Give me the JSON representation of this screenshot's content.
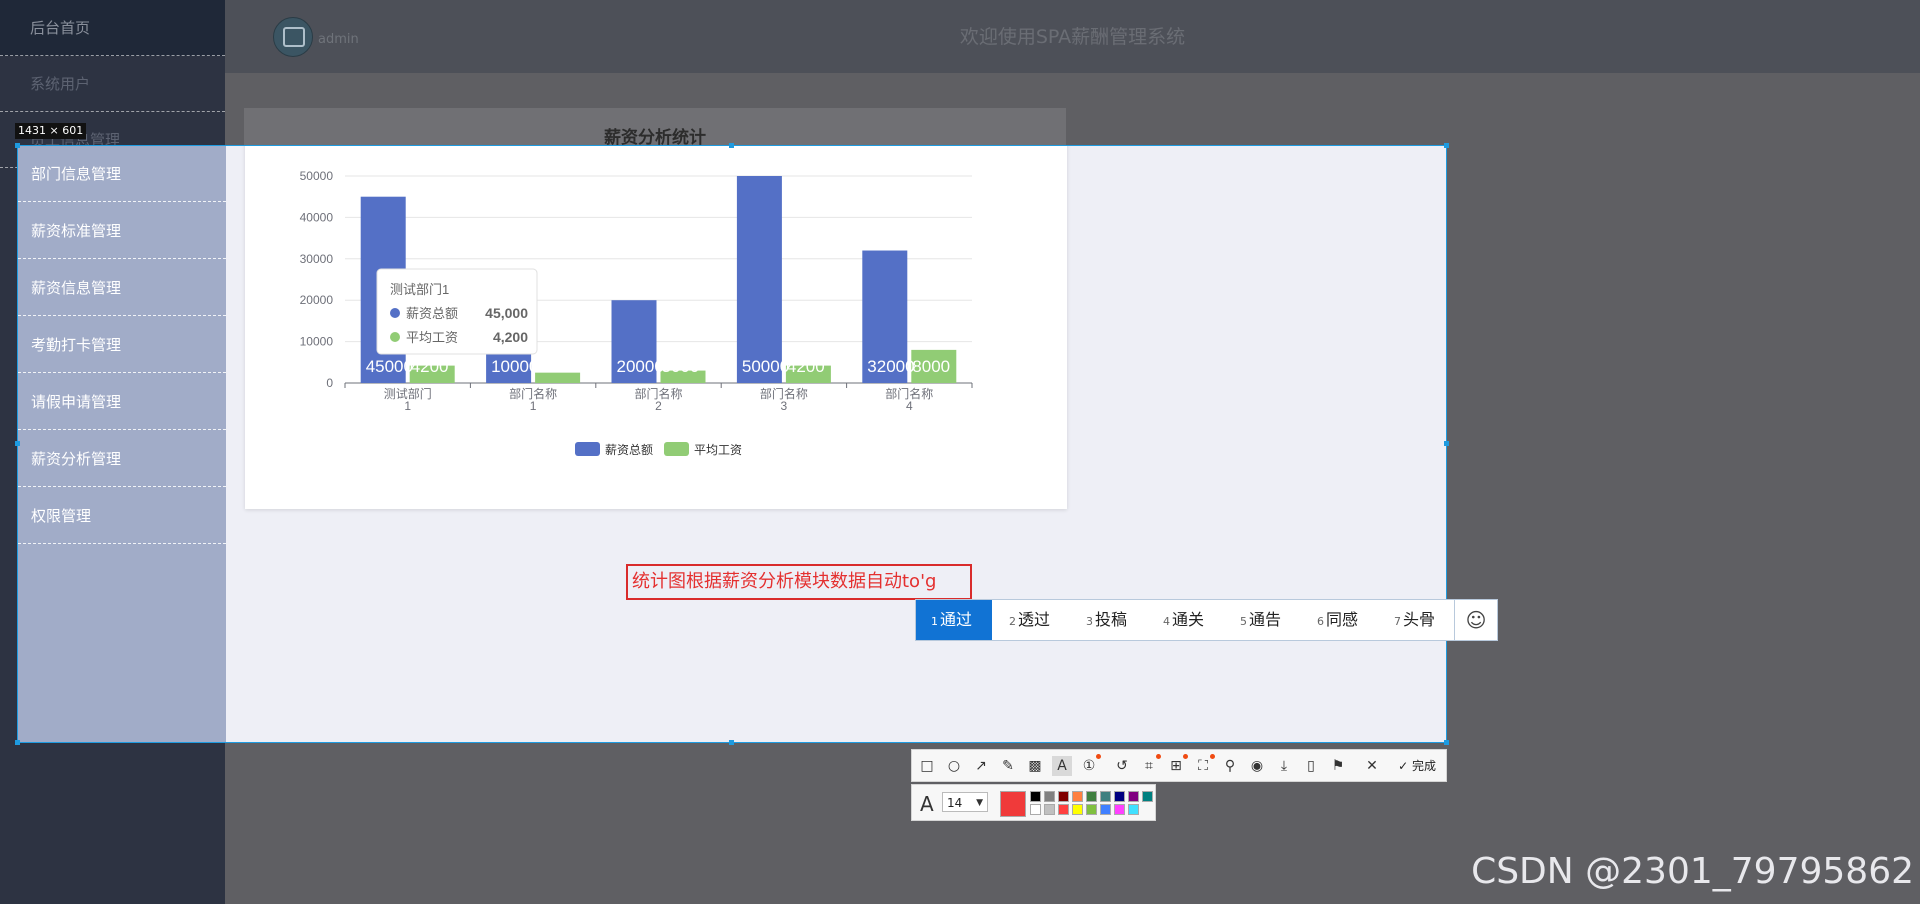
{
  "header": {
    "title": "欢迎使用SPA薪酬管理系统",
    "admin_name": "admin"
  },
  "sidebar": {
    "items": [
      {
        "label": "后台首页"
      },
      {
        "label": "系统用户"
      },
      {
        "label": "员工信息管理"
      },
      {
        "label": "部门信息管理"
      },
      {
        "label": "薪资标准管理"
      },
      {
        "label": "薪资信息管理"
      },
      {
        "label": "考勤打卡管理"
      },
      {
        "label": "请假申请管理"
      },
      {
        "label": "薪资分析管理"
      },
      {
        "label": "权限管理"
      }
    ]
  },
  "screenshot_tool": {
    "size_label": "1431 × 601",
    "text_annotation": "统计图根据薪资分析模块数据自动to'g",
    "font_size": "14",
    "done_label": "完成",
    "current_color": "#f03a3a",
    "palette": [
      "#000000",
      "#808080",
      "#800000",
      "#ff8040",
      "#408040",
      "#408080",
      "#000080",
      "#800080",
      "#008080",
      "#ffffff",
      "#c0c0c0",
      "#ff4040",
      "#ffff00",
      "#80c040",
      "#4080ff",
      "#ff40ff",
      "#40e0ff"
    ],
    "tools": [
      "rectangle-icon",
      "ellipse-icon",
      "arrow-icon",
      "pencil-icon",
      "mosaic-icon",
      "text-icon",
      "number-icon",
      "undo-icon",
      "ocr-icon",
      "translate-icon",
      "scan-icon",
      "pin-icon",
      "record-icon",
      "download-icon",
      "long-screenshot-icon",
      "bookmark-icon",
      "close-icon"
    ]
  },
  "ime": {
    "candidates": [
      {
        "num": "1",
        "text": "通过"
      },
      {
        "num": "2",
        "text": "透过"
      },
      {
        "num": "3",
        "text": "投稿"
      },
      {
        "num": "4",
        "text": "通关"
      },
      {
        "num": "5",
        "text": "通告"
      },
      {
        "num": "6",
        "text": "同感"
      },
      {
        "num": "7",
        "text": "头骨"
      }
    ],
    "emoji": "☺"
  },
  "watermark": "CSDN @2301_79795862",
  "chart_data": {
    "type": "bar",
    "title": "薪资分析统计",
    "categories": [
      "测试部门1",
      "部门名称1",
      "部门名称2",
      "部门名称3",
      "部门名称4"
    ],
    "category_lines": [
      [
        "测试部门",
        "1"
      ],
      [
        "部门名称",
        "1"
      ],
      [
        "部门名称",
        "2"
      ],
      [
        "部门名称",
        "3"
      ],
      [
        "部门名称",
        "4"
      ]
    ],
    "series": [
      {
        "name": "薪资总额",
        "values": [
          45000,
          10000,
          20000,
          50000,
          32000
        ],
        "color": "#5470c6"
      },
      {
        "name": "平均工资",
        "values": [
          4200,
          2500,
          3000,
          4200,
          8000
        ],
        "color": "#91cc75"
      }
    ],
    "y_ticks": [
      "0",
      "10000",
      "20000",
      "30000",
      "40000",
      "50000"
    ],
    "ylim": [
      0,
      50000
    ],
    "legend_position": "bottom",
    "tooltip": {
      "title": "测试部门1",
      "rows": [
        {
          "name": "薪资总额",
          "value": "45,000"
        },
        {
          "name": "平均工资",
          "value": "4,200"
        }
      ]
    }
  }
}
